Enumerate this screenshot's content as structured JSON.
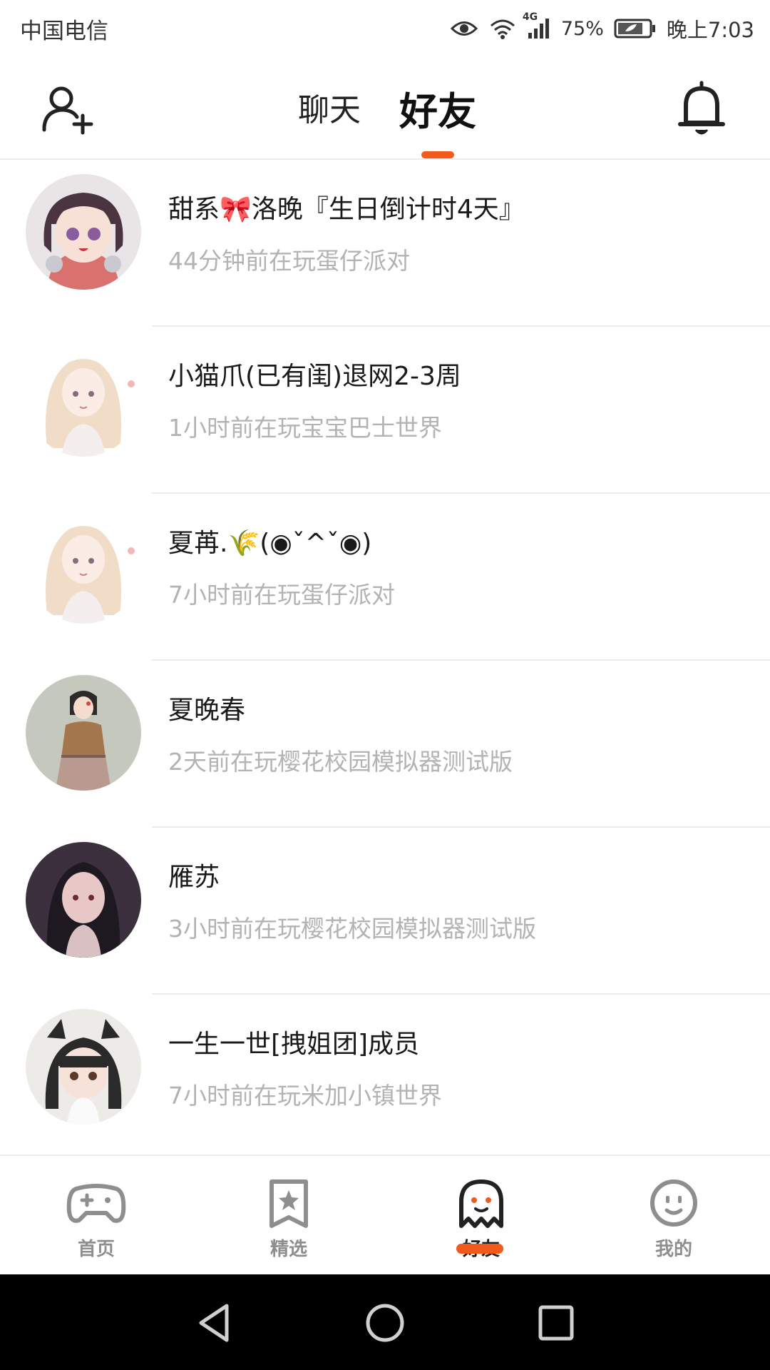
{
  "status_bar": {
    "carrier": "中国电信",
    "network": "4G",
    "battery": "75%",
    "time": "晚上7:03"
  },
  "header": {
    "tabs": [
      {
        "label": "聊天",
        "active": false
      },
      {
        "label": "好友",
        "active": true
      }
    ],
    "icons": [
      "add-friend-icon",
      "bell-icon"
    ],
    "accent_color": "#f25a1c"
  },
  "friends": [
    {
      "name": "甜系🎀洛晚『生日倒计时4天』",
      "status": "44分钟前在玩蛋仔派对"
    },
    {
      "name": "小猫爪(已有闺)退网2-3周",
      "status": "1小时前在玩宝宝巴士世界"
    },
    {
      "name": "夏苒.🌾(◉ˇ^ˇ◉)",
      "status": "7小时前在玩蛋仔派对"
    },
    {
      "name": "夏晚春",
      "status": "2天前在玩樱花校园模拟器测试版"
    },
    {
      "name": "雁苏",
      "status": "3小时前在玩樱花校园模拟器测试版"
    },
    {
      "name": "一生一世[拽姐团]成员",
      "status": "7小时前在玩米加小镇世界"
    }
  ],
  "bottom_nav": [
    {
      "label": "首页",
      "icon": "gamepad-icon",
      "active": false
    },
    {
      "label": "精选",
      "icon": "star-bookmark-icon",
      "active": false
    },
    {
      "label": "好友",
      "icon": "ghost-icon",
      "active": true
    },
    {
      "label": "我的",
      "icon": "smiley-icon",
      "active": false
    }
  ],
  "system_nav": [
    "back-icon",
    "home-icon",
    "recents-icon"
  ]
}
